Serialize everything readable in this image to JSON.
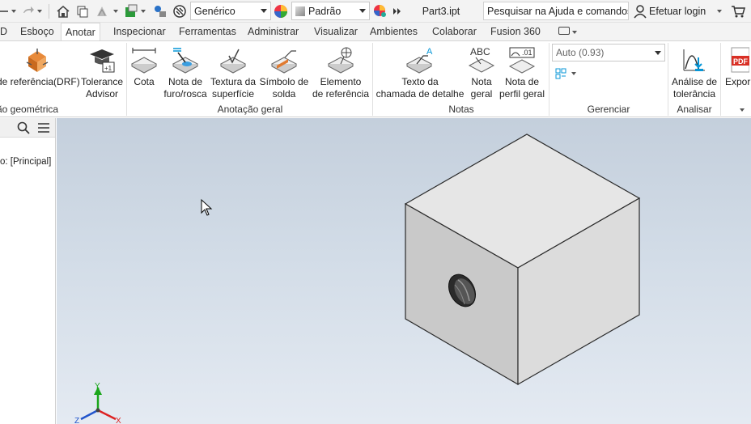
{
  "qat": {
    "material": "Genérico",
    "appearance": "Padrão",
    "file_name": "Part3.ipt",
    "search_placeholder": "Pesquisar na Ajuda e comandos.",
    "login": "Efetuar login"
  },
  "tabs": [
    "D",
    "Esboço",
    "Anotar",
    "Inspecionar",
    "Ferramentas",
    "Administrar",
    "Visualizar",
    "Ambientes",
    "Colaborar",
    "Fusion 360"
  ],
  "active_tab": "Anotar",
  "ribbon": {
    "drf": {
      "label": "de referência(DRF)"
    },
    "tolerance_advisor": {
      "line1": "Tolerance",
      "line2": "Advisor"
    },
    "group_geometric": "ão geométrica",
    "cota": "Cota",
    "nota_furo": {
      "line1": "Nota de",
      "line2": "furo/rosca"
    },
    "textura": {
      "line1": "Textura da",
      "line2": "superfície"
    },
    "simbolo_solda": {
      "line1": "Símbolo de",
      "line2": "solda"
    },
    "elemento_ref": {
      "line1": "Elemento",
      "line2": "de referência"
    },
    "group_anotacao": "Anotação geral",
    "texto_chamada": {
      "line1": "Texto da",
      "line2": "chamada de detalhe"
    },
    "nota_geral": {
      "line1": "Nota",
      "line2": "geral"
    },
    "nota_perfil": {
      "line1": "Nota de",
      "line2": "perfil geral"
    },
    "group_notas": "Notas",
    "auto_combo": "Auto (0.93)",
    "group_gerenciar": "Gerenciar",
    "analise_tol": {
      "line1": "Análise de",
      "line2": "tolerância"
    },
    "group_analisar": "Analisar",
    "export": "Expor",
    "icon_abc": "ABC",
    "icon_01": ".01",
    "icon_a": "A",
    "icon_pdf": "PDF"
  },
  "browser": {
    "item": "o: [Principal]"
  },
  "viewport": {
    "axis_x": "X",
    "axis_y": "Y",
    "axis_z": "Z"
  },
  "colors": {
    "accent": "#0696d7",
    "ribbon_bg": "#ffffff",
    "chrome_bg": "#f3f3f3",
    "viewport_top": "#c4cfdc",
    "viewport_bottom": "#e4eaf2",
    "cube_top": "#e6e6e6",
    "cube_left": "#c8c8c8",
    "cube_right": "#dcdcdc"
  }
}
